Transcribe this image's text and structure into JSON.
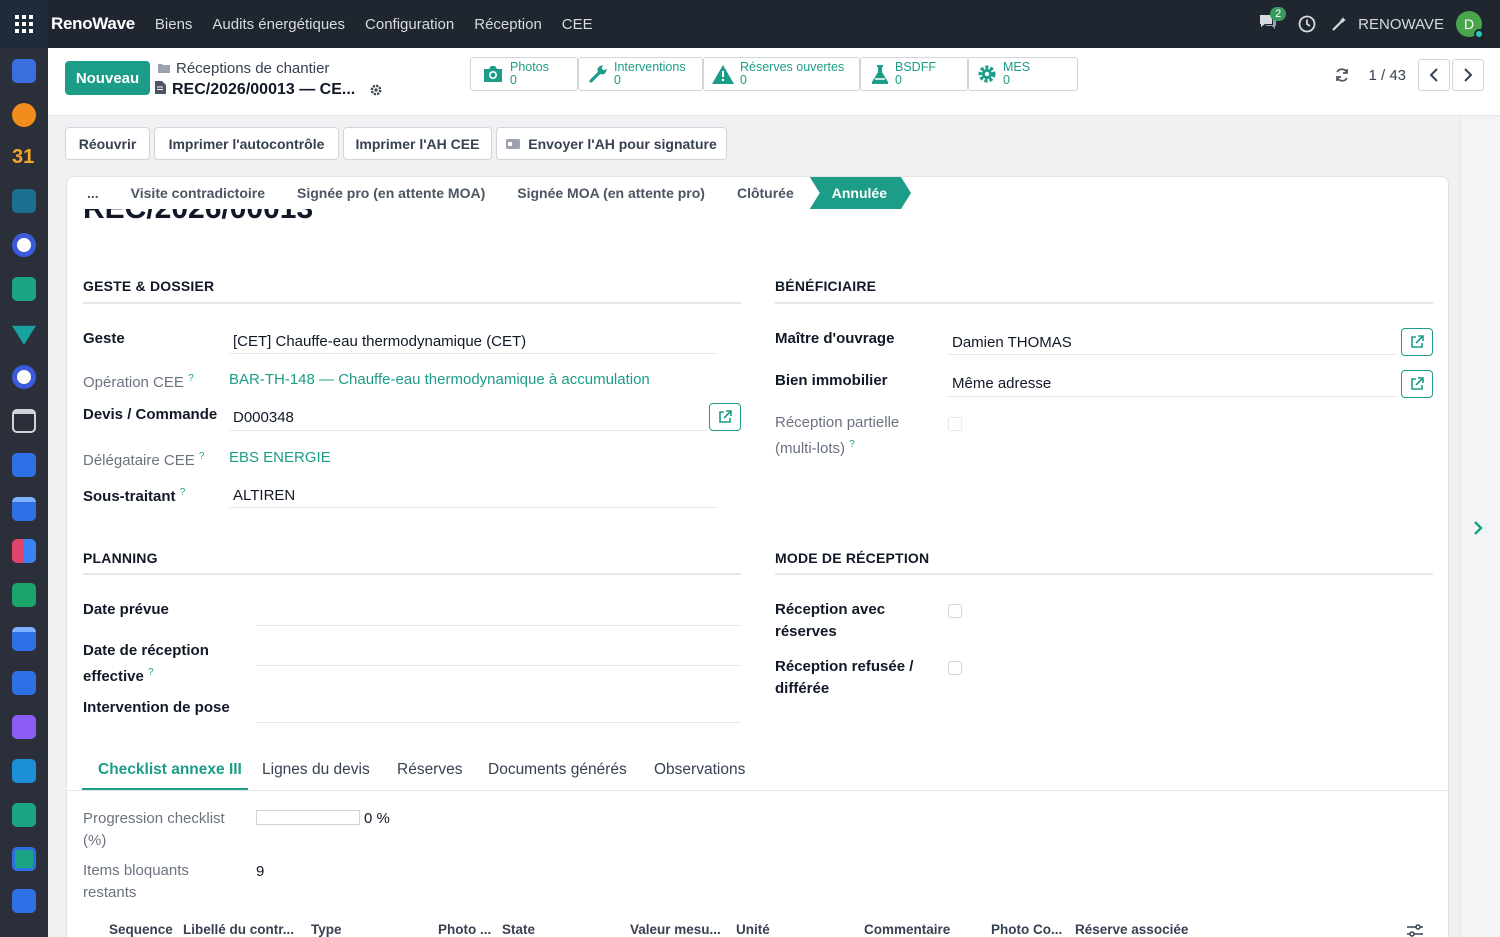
{
  "navbar": {
    "brand": "RenoWave",
    "menu": [
      "Biens",
      "Audits énergétiques",
      "Configuration",
      "Réception",
      "CEE"
    ],
    "chat_count": "2",
    "company": "RENOWAVE",
    "avatar_letter": "D"
  },
  "control_panel": {
    "new_button": "Nouveau",
    "breadcrumb_parent": "Réceptions de chantier",
    "breadcrumb_current": "REC/2026/00013 — CE...",
    "smart_buttons": [
      {
        "label": "Photos",
        "count": "0"
      },
      {
        "label": "Interventions",
        "count": "0"
      },
      {
        "label": "Réserves ouvertes",
        "count": "0"
      },
      {
        "label": "BSDFF",
        "count": "0"
      },
      {
        "label": "MES",
        "count": "0"
      }
    ],
    "pager": "1 / 43"
  },
  "actions": {
    "reopen": "Réouvrir",
    "print_selfcheck": "Imprimer l'autocontrôle",
    "print_ah": "Imprimer l'AH CEE",
    "send_ah": "Envoyer l'AH pour signature"
  },
  "statusbar": {
    "more": "...",
    "stages": [
      "Visite contradictoire",
      "Signée pro (en attente MOA)",
      "Signée MOA (en attente pro)",
      "Clôturée"
    ],
    "active": "Annulée"
  },
  "record": {
    "title": "REC/2026/00013"
  },
  "geste": {
    "section": "GESTE & DOSSIER",
    "geste_label": "Geste",
    "geste_value": "[CET] Chauffe-eau thermodynamique (CET)",
    "operation_label": "Opération CEE",
    "operation_value": "BAR-TH-148 — Chauffe-eau thermodynamique à accumulation",
    "devis_label": "Devis / Commande",
    "devis_value": "D000348",
    "delegataire_label": "Délégataire CEE",
    "delegataire_value": "EBS ENERGIE",
    "sous_traitant_label": "Sous-traitant",
    "sous_traitant_value": "ALTIREN"
  },
  "beneficiaire": {
    "section": "BÉNÉFICIAIRE",
    "moa_label": "Maître d'ouvrage",
    "moa_value": "Damien THOMAS",
    "bien_label": "Bien immobilier",
    "bien_value": "Même adresse",
    "partielle_label_1": "Réception partielle",
    "partielle_label_2": "(multi-lots)"
  },
  "planning": {
    "section": "PLANNING",
    "date_prevue": "Date prévue",
    "date_effective_1": "Date de réception",
    "date_effective_2": "effective",
    "intervention": "Intervention de pose"
  },
  "mode": {
    "section": "MODE DE RÉCEPTION",
    "avec_reserves_1": "Réception avec",
    "avec_reserves_2": "réserves",
    "refusee_1": "Réception refusée /",
    "refusee_2": "différée"
  },
  "tabs": [
    "Checklist annexe III",
    "Lignes du devis",
    "Réserves",
    "Documents générés",
    "Observations"
  ],
  "checklist": {
    "progress_label_1": "Progression checklist",
    "progress_label_2": "(%)",
    "progress_value": 0,
    "progress_text": "0 %",
    "blocking_label_1": "Items bloquants",
    "blocking_label_2": "restants",
    "blocking_value": "9",
    "columns": [
      "Sequence",
      "Libellé du contr...",
      "Type",
      "Photo ...",
      "State",
      "Valeur mesu...",
      "Unité",
      "Commentaire",
      "Photo Co...",
      "Réserve associée"
    ]
  },
  "colors": {
    "accent": "#1c9d87",
    "navbar": "#1f2630"
  }
}
